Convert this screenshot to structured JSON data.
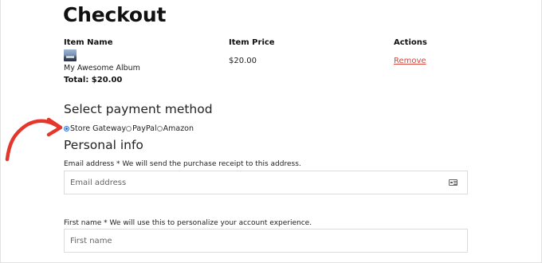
{
  "page": {
    "title": "Checkout"
  },
  "cart": {
    "headers": {
      "name": "Item Name",
      "price": "Item Price",
      "actions": "Actions"
    },
    "items": [
      {
        "name": "My Awesome Album",
        "price": "$20.00",
        "action": "Remove"
      }
    ],
    "total": "Total: $20.00"
  },
  "payment": {
    "heading": "Select payment method",
    "options": [
      {
        "label": "Store Gateway",
        "selected": true
      },
      {
        "label": "PayPal",
        "selected": false
      },
      {
        "label": "Amazon",
        "selected": false
      }
    ]
  },
  "personal": {
    "heading": "Personal info",
    "email": {
      "label": "Email address * We will send the purchase receipt to this address.",
      "placeholder": "Email address",
      "value": ""
    },
    "first_name": {
      "label": "First name * We will use this to personalize your account experience.",
      "placeholder": "First name",
      "value": ""
    }
  },
  "colors": {
    "remove_link": "#d9473f",
    "annotation_arrow": "#e5362c",
    "radio_selected": "#2b6fd4"
  },
  "icons": {
    "email_field": "contact-card-icon",
    "annotation": "curved-arrow-icon"
  }
}
